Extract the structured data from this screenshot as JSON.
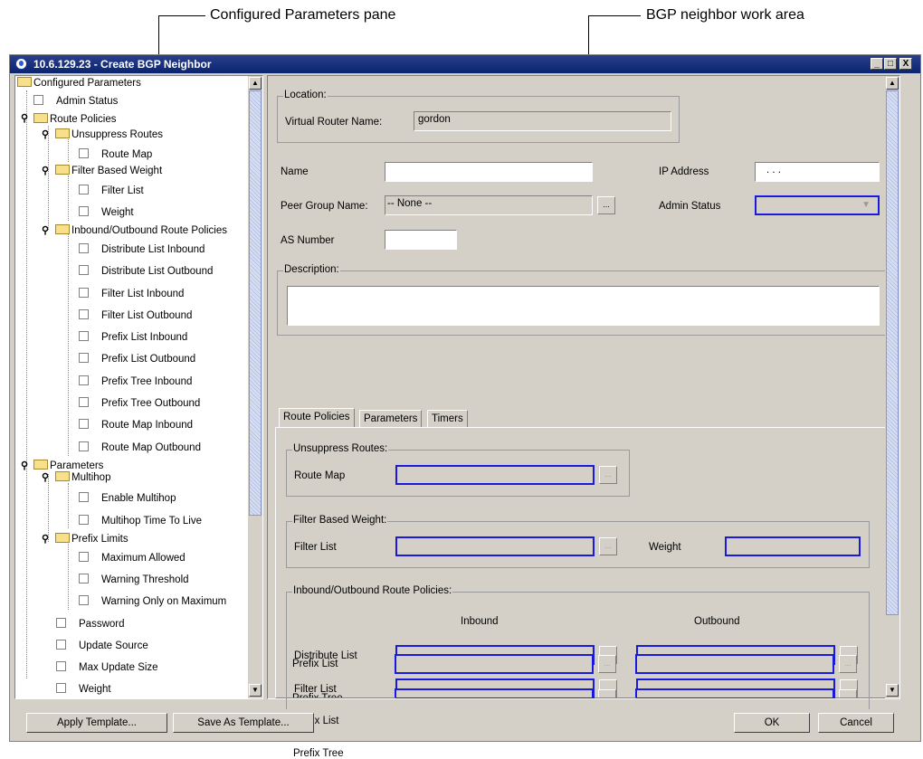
{
  "callouts": {
    "left": "Configured Parameters pane",
    "right": "BGP neighbor work area"
  },
  "window": {
    "title": "10.6.129.23 - Create BGP Neighbor",
    "minimize": "_",
    "maximize": "□",
    "close": "X"
  },
  "tree": {
    "root": "Configured Parameters",
    "admin_status": "Admin Status",
    "route_policies": "Route Policies",
    "unsuppress_routes": "Unsuppress Routes",
    "route_map": "Route Map",
    "filter_based_weight": "Filter Based Weight",
    "filter_list": "Filter List",
    "weight": "Weight",
    "inout_policies": "Inbound/Outbound Route Policies",
    "distribute_list_inbound": "Distribute List Inbound",
    "distribute_list_outbound": "Distribute List Outbound",
    "filter_list_inbound": "Filter List Inbound",
    "filter_list_outbound": "Filter List Outbound",
    "prefix_list_inbound": "Prefix List Inbound",
    "prefix_list_outbound": "Prefix List Outbound",
    "prefix_tree_inbound": "Prefix Tree Inbound",
    "prefix_tree_outbound": "Prefix Tree Outbound",
    "route_map_inbound": "Route Map Inbound",
    "route_map_outbound": "Route Map Outbound",
    "parameters": "Parameters",
    "multihop": "Multihop",
    "enable_multihop": "Enable Multihop",
    "multihop_ttl": "Multihop Time To Live",
    "prefix_limits": "Prefix Limits",
    "maximum_allowed": "Maximum Allowed",
    "warning_threshold": "Warning Threshold",
    "warning_only_max": "Warning Only on Maximum",
    "password": "Password",
    "update_source": "Update Source",
    "max_update_size": "Max Update Size",
    "weight2": "Weight"
  },
  "form": {
    "location_legend": "Location:",
    "vr_name_label": "Virtual Router Name:",
    "vr_name_value": "gordon",
    "name_label": "Name",
    "name_value": "",
    "ip_label": "IP Address",
    "ip_value": ". . .",
    "peer_group_label": "Peer Group Name:",
    "peer_group_value": "-- None --",
    "admin_status_label": "Admin Status",
    "as_number_label": "AS Number",
    "as_number_value": "",
    "description_legend": "Description:",
    "description_value": "",
    "browse": "..."
  },
  "tabs": [
    "Route Policies",
    "Parameters",
    "Timers"
  ],
  "route_policies_tab": {
    "unsuppress_legend": "Unsuppress Routes:",
    "route_map_label": "Route Map",
    "fbw_legend": "Filter Based Weight:",
    "filter_list_label": "Filter List",
    "weight_label": "Weight",
    "inout_legend": "Inbound/Outbound Route Policies:",
    "inbound_header": "Inbound",
    "outbound_header": "Outbound",
    "distribute_list_label": "Distribute List",
    "filter_list_label2": "Filter List",
    "prefix_list_label": "Prefix List",
    "prefix_tree_label": "Prefix Tree"
  },
  "buttons": {
    "apply_template": "Apply Template...",
    "save_as_template": "Save As Template...",
    "ok": "OK",
    "cancel": "Cancel"
  },
  "colors": {
    "title_bar": "#0a2470",
    "required_border": "#1a1adb",
    "window_bg": "#d4d0c8"
  }
}
